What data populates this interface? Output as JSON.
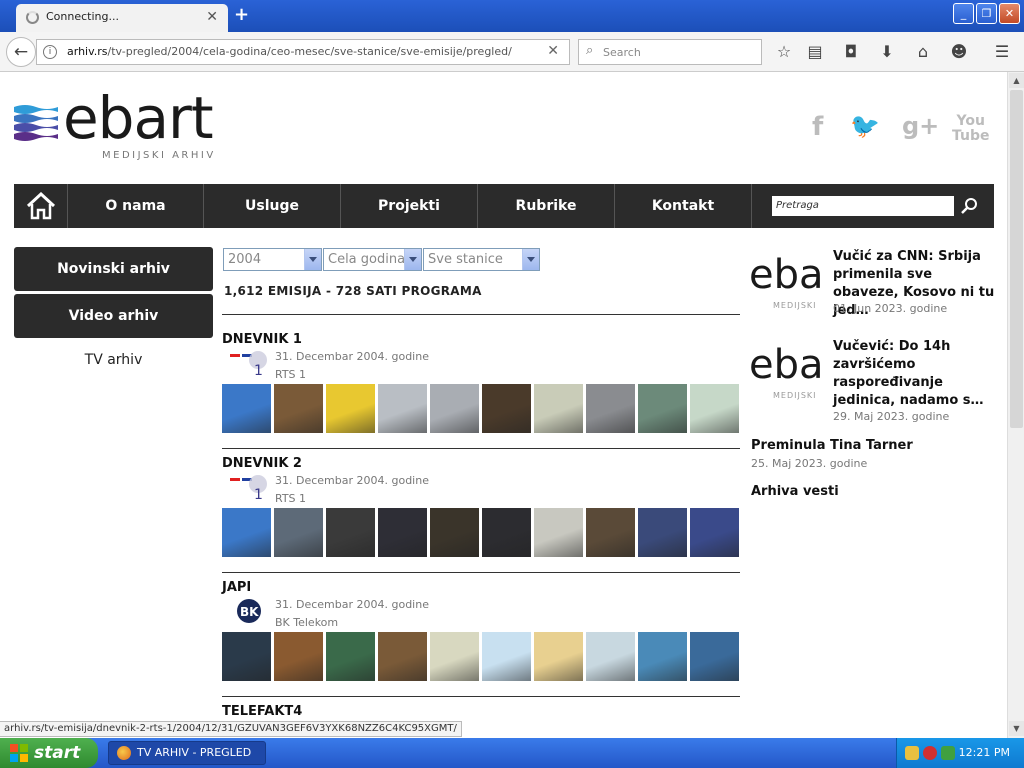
{
  "browser": {
    "tab_title": "Connecting...",
    "url_domain": "arhiv.rs",
    "url_path": "/tv-pregled/2004/cela-godina/ceo-mesec/sve-stanice/sve-emisije/pregled/",
    "search_placeholder": "Search"
  },
  "site": {
    "logo_text": "ebart",
    "logo_sub": "MEDIJSKI ARHIV",
    "nav": [
      "O nama",
      "Usluge",
      "Projekti",
      "Rubrike",
      "Kontakt"
    ],
    "search_placeholder": "Pretraga",
    "sidebar": {
      "buttons": [
        "Novinski arhiv",
        "Video arhiv"
      ],
      "link": "TV arhiv"
    },
    "filters": {
      "year": "2004",
      "period": "Cela godina",
      "station": "Sve stanice"
    },
    "summary": "1,612 EMISIJA - 728 SATI PROGRAMA",
    "shows": [
      {
        "name": "DNEVNIK 1",
        "date": "31. Decembar 2004. godine",
        "channel": "RTS 1",
        "logo": "rts-logo",
        "thumb_colors": [
          "#3b78c8",
          "#7a5a38",
          "#e8c830",
          "#b9bec4",
          "#a9adb3",
          "#4a3a2a",
          "#c9ccb8",
          "#8a8c90",
          "#6c8a7a",
          "#c6d8c8"
        ]
      },
      {
        "name": "DNEVNIK 2",
        "date": "31. Decembar 2004. godine",
        "channel": "RTS 1",
        "logo": "rts-logo",
        "thumb_colors": [
          "#3b78c8",
          "#5d6a78",
          "#3a3a3a",
          "#2e2e36",
          "#3a342a",
          "#2c2c30",
          "#c8c8c0",
          "#5a4a38",
          "#3a4a7a",
          "#3a4a8a"
        ]
      },
      {
        "name": "JAPI",
        "date": "31. Decembar 2004. godine",
        "channel": "BK Telekom",
        "logo": "bk-logo",
        "thumb_colors": [
          "#2a3a4a",
          "#8a5a30",
          "#3a6a4a",
          "#7a5a38",
          "#d8d8c0",
          "#c8e0f0",
          "#e8d090",
          "#c8d8e0",
          "#4a8ab8",
          "#3a6a9a"
        ]
      }
    ],
    "next_show": "TELEFAKT4",
    "news": [
      {
        "title": "Vučić za CNN: Srbija primenila sve obaveze, Kosovo ni tu jed…",
        "date": "01. Jun 2023. godine"
      },
      {
        "title": "Vučević: Do 14h završićemo raspoređivanje jedinica, nadamo s…",
        "date": "29. Maj 2023. godine"
      },
      {
        "title": "Preminula Tina Tarner",
        "date": "25. Maj 2023. godine"
      }
    ],
    "news_archive": "Arhiva vesti",
    "social": [
      "facebook-icon",
      "twitter-icon",
      "googleplus-icon",
      "youtube-icon"
    ]
  },
  "status_url": "arhiv.rs/tv-emisija/dnevnik-2-rts-1/2004/12/31/GZUVAN3GEF6V3YXK68NZZ6C4KC95XGMT/",
  "taskbar": {
    "start": "start",
    "task": "TV ARHIV - PREGLED ...",
    "clock": "12:21 PM"
  }
}
